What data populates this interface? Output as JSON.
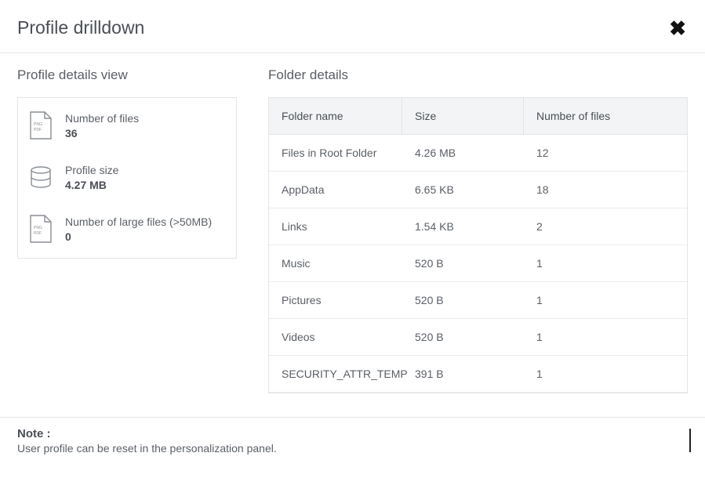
{
  "header": {
    "title": "Profile drilldown"
  },
  "details": {
    "section_title": "Profile details view",
    "stats": {
      "num_files": {
        "label": "Number of files",
        "value": "36"
      },
      "profile_size": {
        "label": "Profile size",
        "value": "4.27 MB"
      },
      "large_files": {
        "label": "Number of large files (>50MB)",
        "value": "0"
      }
    }
  },
  "folders": {
    "section_title": "Folder details",
    "columns": {
      "name": "Folder name",
      "size": "Size",
      "count": "Number of files"
    },
    "rows": [
      {
        "name": "Files in Root Folder",
        "size": "4.26 MB",
        "count": "12"
      },
      {
        "name": "AppData",
        "size": "6.65 KB",
        "count": "18"
      },
      {
        "name": "Links",
        "size": "1.54 KB",
        "count": "2"
      },
      {
        "name": "Music",
        "size": "520 B",
        "count": "1"
      },
      {
        "name": "Pictures",
        "size": "520 B",
        "count": "1"
      },
      {
        "name": "Videos",
        "size": "520 B",
        "count": "1"
      },
      {
        "name": "SECURITY_ATTR_TEMP",
        "size": "391 B",
        "count": "1"
      }
    ]
  },
  "footer": {
    "title": "Note :",
    "text": "User profile can be reset in the personalization panel."
  }
}
